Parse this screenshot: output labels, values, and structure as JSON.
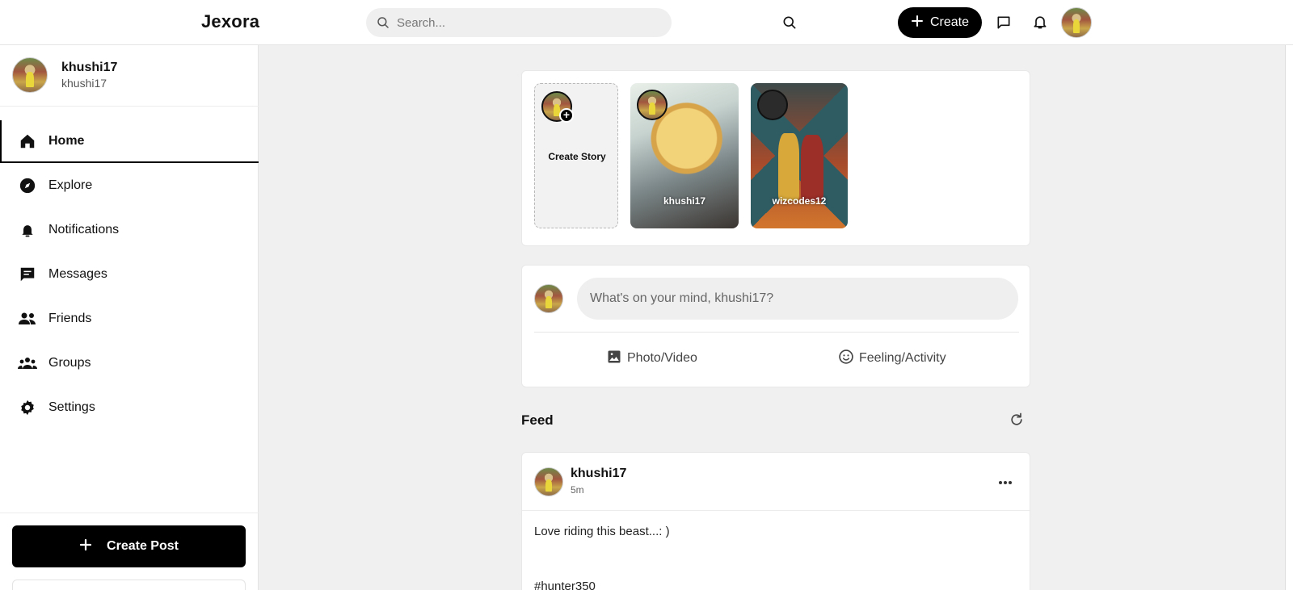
{
  "app": {
    "brand": "Jexora"
  },
  "header": {
    "search_placeholder": "Search...",
    "create_label": "Create"
  },
  "user": {
    "name": "khushi17",
    "handle": "khushi17"
  },
  "nav": {
    "items": [
      {
        "label": "Home",
        "icon": "home-icon",
        "active": true
      },
      {
        "label": "Explore",
        "icon": "compass-icon"
      },
      {
        "label": "Notifications",
        "icon": "bell-icon"
      },
      {
        "label": "Messages",
        "icon": "message-icon"
      },
      {
        "label": "Friends",
        "icon": "friends-icon"
      },
      {
        "label": "Groups",
        "icon": "groups-icon"
      },
      {
        "label": "Settings",
        "icon": "gear-icon"
      }
    ],
    "create_post_label": "Create Post"
  },
  "stories": {
    "create_label": "Create Story",
    "items": [
      {
        "user": "khushi17"
      },
      {
        "user": "wizcodes12"
      }
    ]
  },
  "composer": {
    "placeholder": "What's on your mind, khushi17?",
    "photo_label": "Photo/Video",
    "feeling_label": "Feeling/Activity"
  },
  "feed": {
    "title": "Feed",
    "posts": [
      {
        "author": "khushi17",
        "time": "5m",
        "text": "Love riding this beast...: )",
        "hashtag": "#hunter350"
      }
    ]
  },
  "colors": {
    "accent": "#000000",
    "surface": "#ffffff",
    "background": "#f0f0f0"
  }
}
